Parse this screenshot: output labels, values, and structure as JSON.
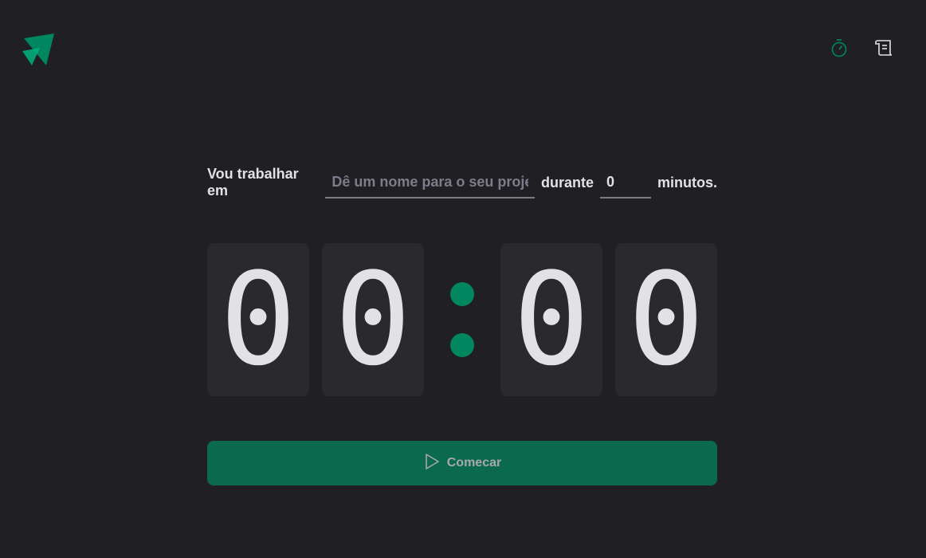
{
  "header": {
    "logo_icon": "ignite-triangle-logo",
    "nav": [
      {
        "icon": "timer-icon",
        "color": "#00875f"
      },
      {
        "icon": "scroll-icon",
        "color": "#e1e1e6"
      }
    ]
  },
  "form": {
    "task_label": "Vou trabalhar em",
    "task_placeholder": "Dê um nome para o seu projeto",
    "during_label": "durante",
    "minutes_value": "0",
    "minutes_suffix": "minutos."
  },
  "countdown": {
    "minutes_tens": "0",
    "minutes_ones": "0",
    "separator": ":",
    "seconds_tens": "0",
    "seconds_ones": "0"
  },
  "start_button": {
    "label": "Comecar",
    "icon": "play-icon",
    "disabled": true
  },
  "colors": {
    "background": "#202024",
    "accent": "#00875f",
    "button_disabled": "#0b6a4d",
    "digit_bg": "#29292e",
    "text": "#e1e1e6",
    "placeholder": "#7c7c8a"
  }
}
